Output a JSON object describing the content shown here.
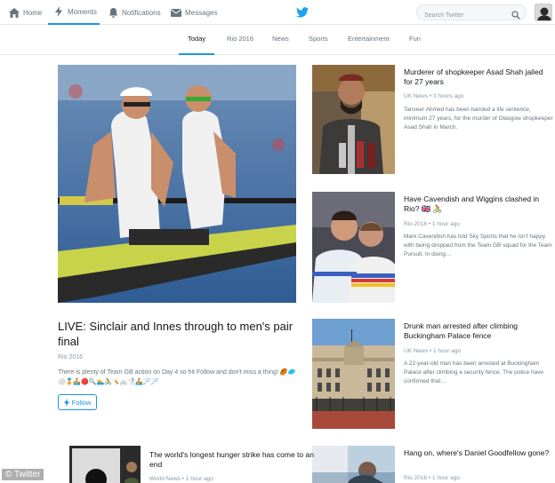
{
  "nav": {
    "home": "Home",
    "moments": "Moments",
    "notifications": "Notifications",
    "messages": "Messages",
    "search_placeholder": "Search Twitter"
  },
  "categories": [
    "Today",
    "Rio 2016",
    "News",
    "Sports",
    "Entertainment",
    "Fun"
  ],
  "hero": {
    "title": "LIVE: Sinclair and Innes through to men's pair final",
    "source": "Rio 2016",
    "desc": "There is plenty of Team GB action on Day 4 so hit Follow and don't miss a thing!",
    "emojis": "🏉🥏⚪🏅🚣🔴🔍🏊🚴🤸🚲🤺🚣🏸🏸",
    "follow_label": "Follow"
  },
  "cards": [
    {
      "title": "Murderer of shopkeeper Asad Shah jailed for 27 years",
      "source": "UK News • 3 hours ago",
      "desc": "Tanveer Ahmed has been handed a life sentence, minimum 27 years, for the murder of Glasgow shopkeeper Asad Shah in March."
    },
    {
      "title": "Have Cavendish and Wiggins clashed in Rio? 🇬🇧 🚴",
      "source": "Rio 2016 • 1 hour ago",
      "desc": "Mark Cavendish has told Sky Sports that he isn't happy with being dropped from the Team GB squad for the Team Pursuit. In doing…"
    },
    {
      "title": "Drunk man arrested after climbing Buckingham Palace fence",
      "source": "UK News • 1 hour ago",
      "desc": "A 22-year-old man has been arrested at Buckingham Palace after climbing a security fence. The police have confirmed that…"
    },
    {
      "title": "Hang on, where's Daniel Goodfellow gone?",
      "source": "Rio 2016 • 1 hour ago",
      "desc": ""
    }
  ],
  "small_card": {
    "title": "The world's longest hunger strike has come to an end",
    "source": "World News • 1 hour ago"
  },
  "watermark": "© Twitter",
  "colors": {
    "accent": "#1b95e0",
    "text": "#14171a",
    "muted": "#66757f"
  }
}
